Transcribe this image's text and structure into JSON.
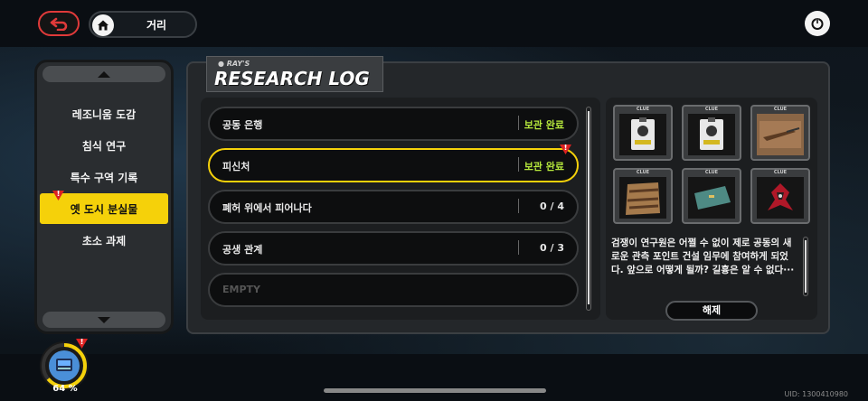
{
  "header": {
    "breadcrumb": "거리"
  },
  "menu": {
    "items": [
      {
        "label": "레조니움 도감",
        "active": false
      },
      {
        "label": "침식 연구",
        "active": false
      },
      {
        "label": "특수 구역 기록",
        "active": false
      },
      {
        "label": "옛 도시 분실물",
        "active": true,
        "alert": true
      },
      {
        "label": "초소 과제",
        "active": false
      }
    ]
  },
  "title": {
    "small": "● RAY'S",
    "big": "RESEARCH LOG"
  },
  "log_rows": [
    {
      "name": "공동 은행",
      "status": "보관 완료",
      "done": true
    },
    {
      "name": "피신처",
      "status": "보관 완료",
      "done": true,
      "selected": true,
      "alert": true
    },
    {
      "name": "폐허 위에서 피어나다",
      "status": "0 / 4",
      "done": false
    },
    {
      "name": "공생 관계",
      "status": "0 / 3",
      "done": false
    },
    {
      "name": "EMPTY",
      "status": "",
      "empty": true
    }
  ],
  "clues": {
    "label": "CLUE",
    "items": [
      {
        "icon": "id-card-icon"
      },
      {
        "icon": "id-card-icon"
      },
      {
        "icon": "rifle-icon"
      },
      {
        "icon": "sandbag-icon"
      },
      {
        "icon": "document-icon"
      },
      {
        "icon": "mech-icon"
      }
    ]
  },
  "description": "검쟁이 연구원은 어쩔 수 없이 제로 공동의 새로운 관측 포인트 건설 임무에 참여하게 되었다. 앞으로 어떻게 될까? 길흉은 알 수 없다···",
  "decrypt_label": "해제",
  "progress": {
    "text": "64 %",
    "value": 0.64
  },
  "uid": "UID: 1300410980",
  "colors": {
    "accent_yellow": "#f5d10a",
    "done_green": "#b6e83c",
    "alert_red": "#dd2222"
  }
}
